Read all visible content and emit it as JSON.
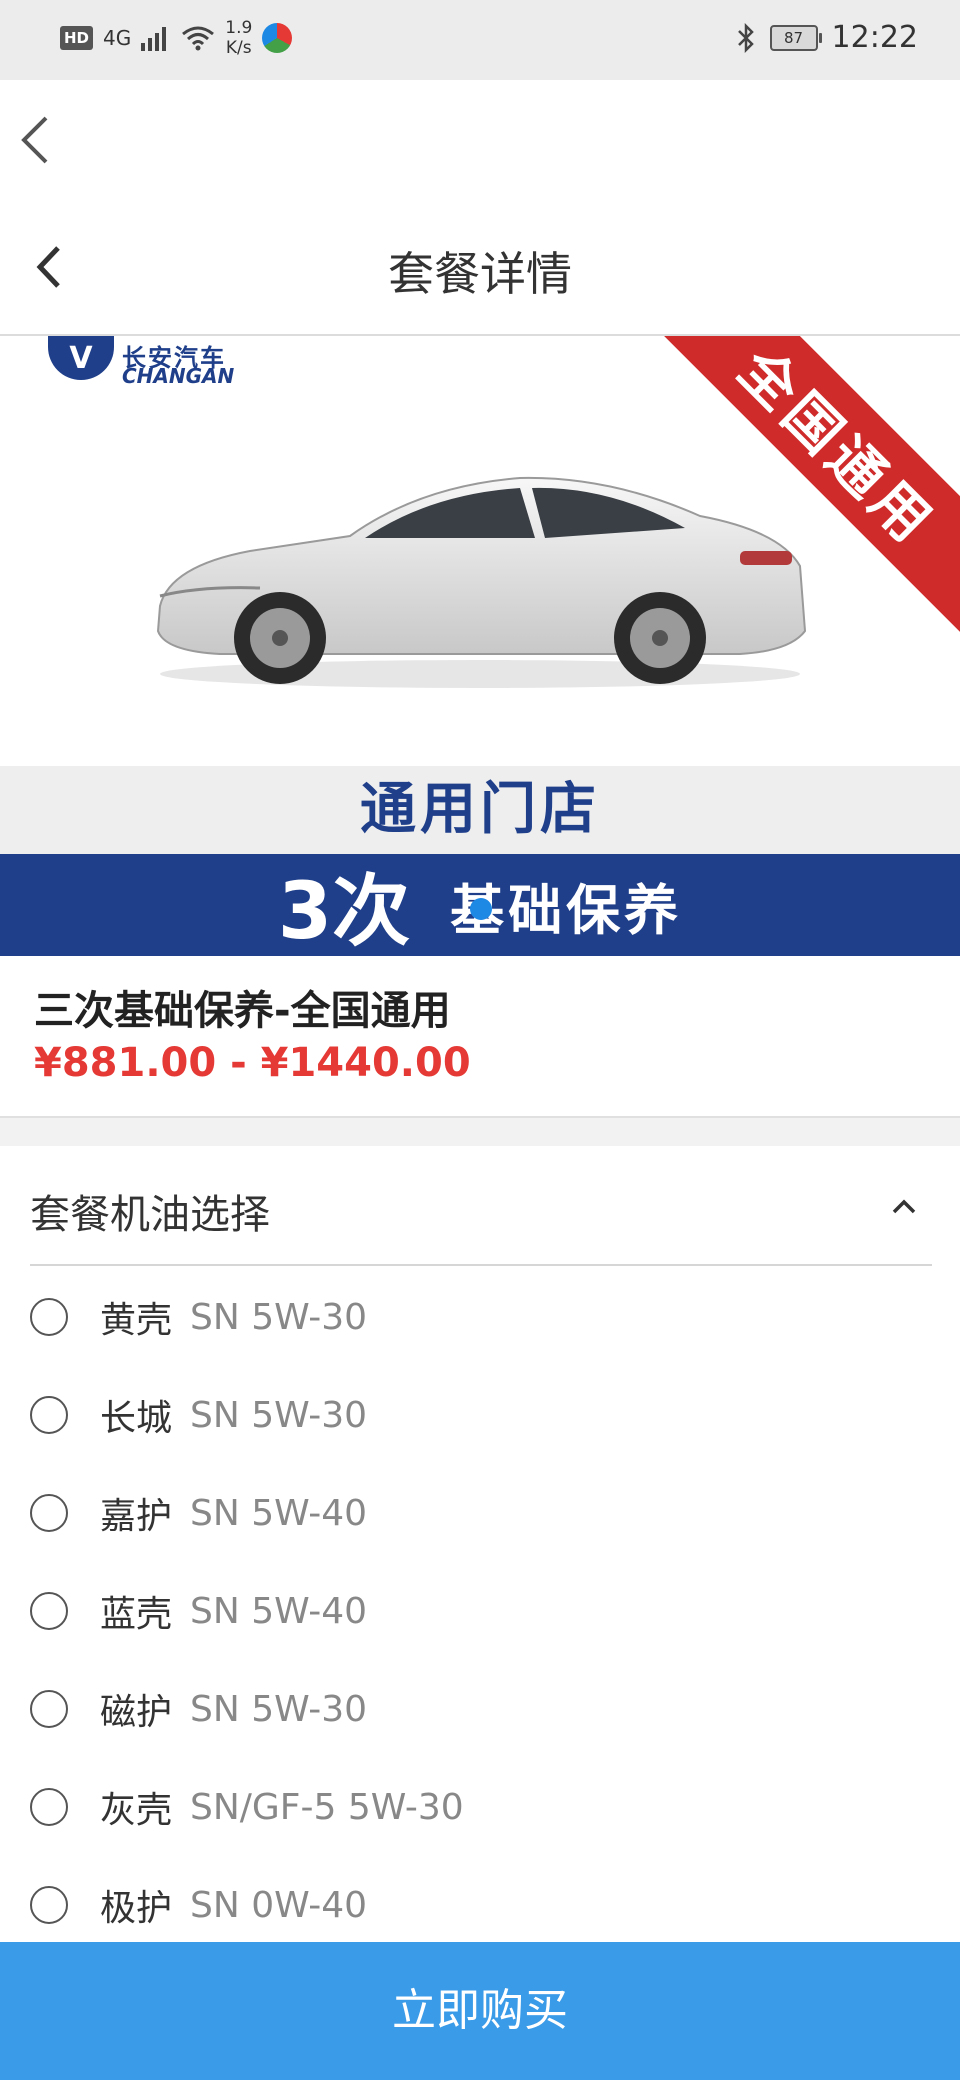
{
  "status_bar": {
    "hd": "HD",
    "network": "4G",
    "speed_value": "1.9",
    "speed_unit": "K/s",
    "battery": "87",
    "time": "12:22"
  },
  "header": {
    "title": "套餐详情"
  },
  "banner": {
    "brand_cn": "长安汽车",
    "brand_en": "CHANGAN",
    "ribbon": "全国通用",
    "store": "通用门店",
    "service_count": "3次",
    "service_name": "基础保养"
  },
  "product": {
    "title": "三次基础保养-全国通用",
    "price_range": "¥881.00 -  ¥1440.00"
  },
  "oil_section": {
    "title": "套餐机油选择",
    "options": [
      {
        "brand": "黄壳",
        "spec": "SN 5W-30"
      },
      {
        "brand": "长城",
        "spec": "SN 5W-30"
      },
      {
        "brand": "嘉护",
        "spec": "SN 5W-40"
      },
      {
        "brand": "蓝壳",
        "spec": "SN 5W-40"
      },
      {
        "brand": "磁护",
        "spec": "SN 5W-30"
      },
      {
        "brand": "灰壳",
        "spec": "SN/GF-5 5W-30"
      },
      {
        "brand": "极护",
        "spec": "SN 0W-40"
      }
    ]
  },
  "buy_button": {
    "label": "立即购买"
  },
  "colors": {
    "price": "#e53935",
    "buy_button": "#3a9be8",
    "brand_blue": "#1f3f8a",
    "ribbon_red": "#cf2b2b"
  }
}
